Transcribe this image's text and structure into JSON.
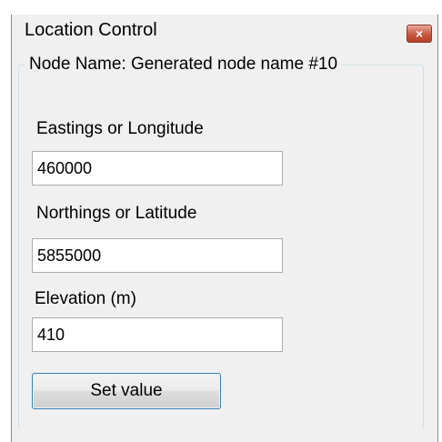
{
  "window": {
    "title": "Location Control",
    "close_glyph": "×"
  },
  "group": {
    "legend": "Node Name: Generated node name #10"
  },
  "fields": {
    "eastings": {
      "label": "Eastings or Longitude",
      "value": "460000"
    },
    "northings": {
      "label": "Northings or Latitude",
      "value": "5855000"
    },
    "elevation": {
      "label": "Elevation (m)",
      "value": "410"
    }
  },
  "buttons": {
    "set_value": "Set value"
  },
  "colors": {
    "window_bg": "#f0f0f0",
    "close_button": "#c8583f",
    "button_border": "#3c7fb1"
  },
  "icons": {
    "close": "close-icon"
  }
}
